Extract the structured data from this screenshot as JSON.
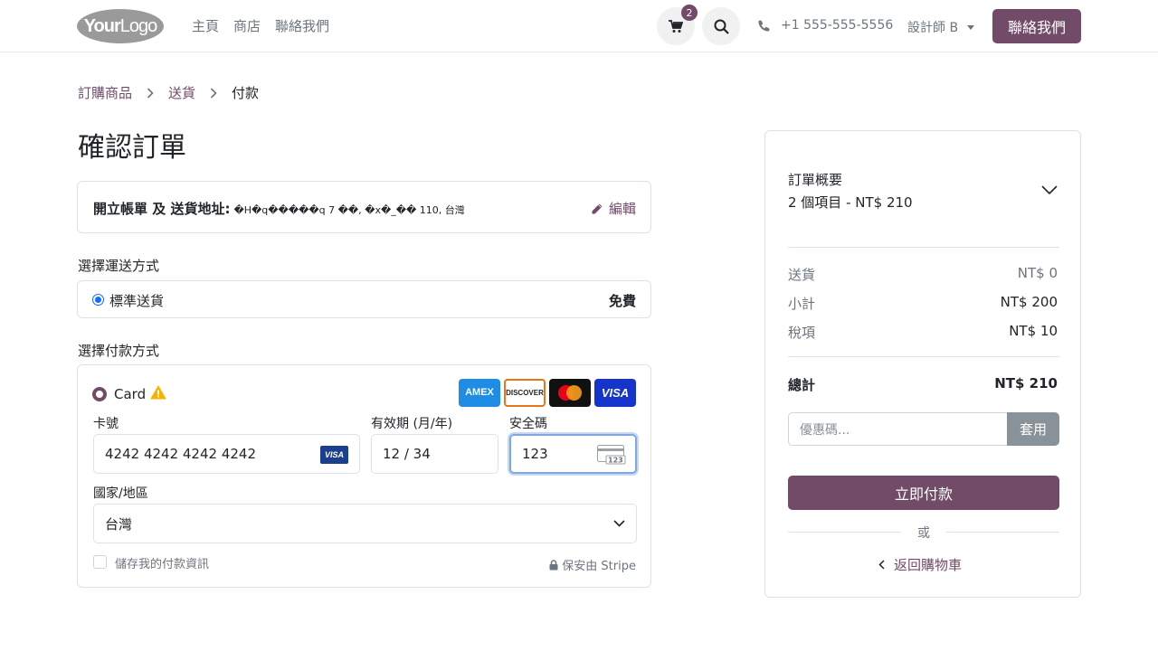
{
  "header": {
    "logo_text_bold": "Your",
    "logo_text_light": "Logo",
    "nav": [
      "主頁",
      "商店",
      "聯絡我們"
    ],
    "cart_count": "2",
    "phone": "+1 555-555-5556",
    "user": "設計師 B",
    "contact_button": "聯絡我們"
  },
  "breadcrumb": [
    "訂購商品",
    "送貨",
    "付款"
  ],
  "page_title": "確認訂單",
  "address": {
    "label": "開立帳單 及 送貨地址:",
    "value": "�H�q�����q 7 ��, �x�_�� 110, 台灣",
    "edit": "編輯"
  },
  "shipping": {
    "title": "選擇運送方式",
    "method": "標準送貨",
    "price": "免費"
  },
  "payment": {
    "title": "選擇付款方式",
    "method": "Card",
    "brands": [
      "AMEX",
      "DISCOVER",
      "Mastercard",
      "VISA"
    ],
    "card_number_label": "卡號",
    "card_number": "4242 4242 4242 4242",
    "card_brand_mini": "VISA",
    "expiry_label": "有效期 (月/年)",
    "expiry": "12 / 34",
    "cvc_label": "安全碼",
    "cvc": "123",
    "country_label": "國家/地區",
    "country": "台灣",
    "save_label": "儲存我的付款資訊",
    "secured": "保安由 Stripe"
  },
  "summary": {
    "title": "訂單概要",
    "items": "2 個項目 -  NT$ 210",
    "rows": [
      {
        "label": "送貨",
        "value": "NT$ 0"
      },
      {
        "label": "小計",
        "value": "NT$ 200"
      },
      {
        "label": "稅項",
        "value": "NT$ 10"
      }
    ],
    "total_label": "總計",
    "total_value": "NT$ 210",
    "coupon_placeholder": "優惠碼...",
    "coupon_button": "套用",
    "pay_button": "立即付款",
    "or": "或",
    "back": "返回購物車"
  },
  "colors": {
    "brand": "#714b67",
    "focus": "#80a8e0",
    "radio": "#0d6efd"
  }
}
